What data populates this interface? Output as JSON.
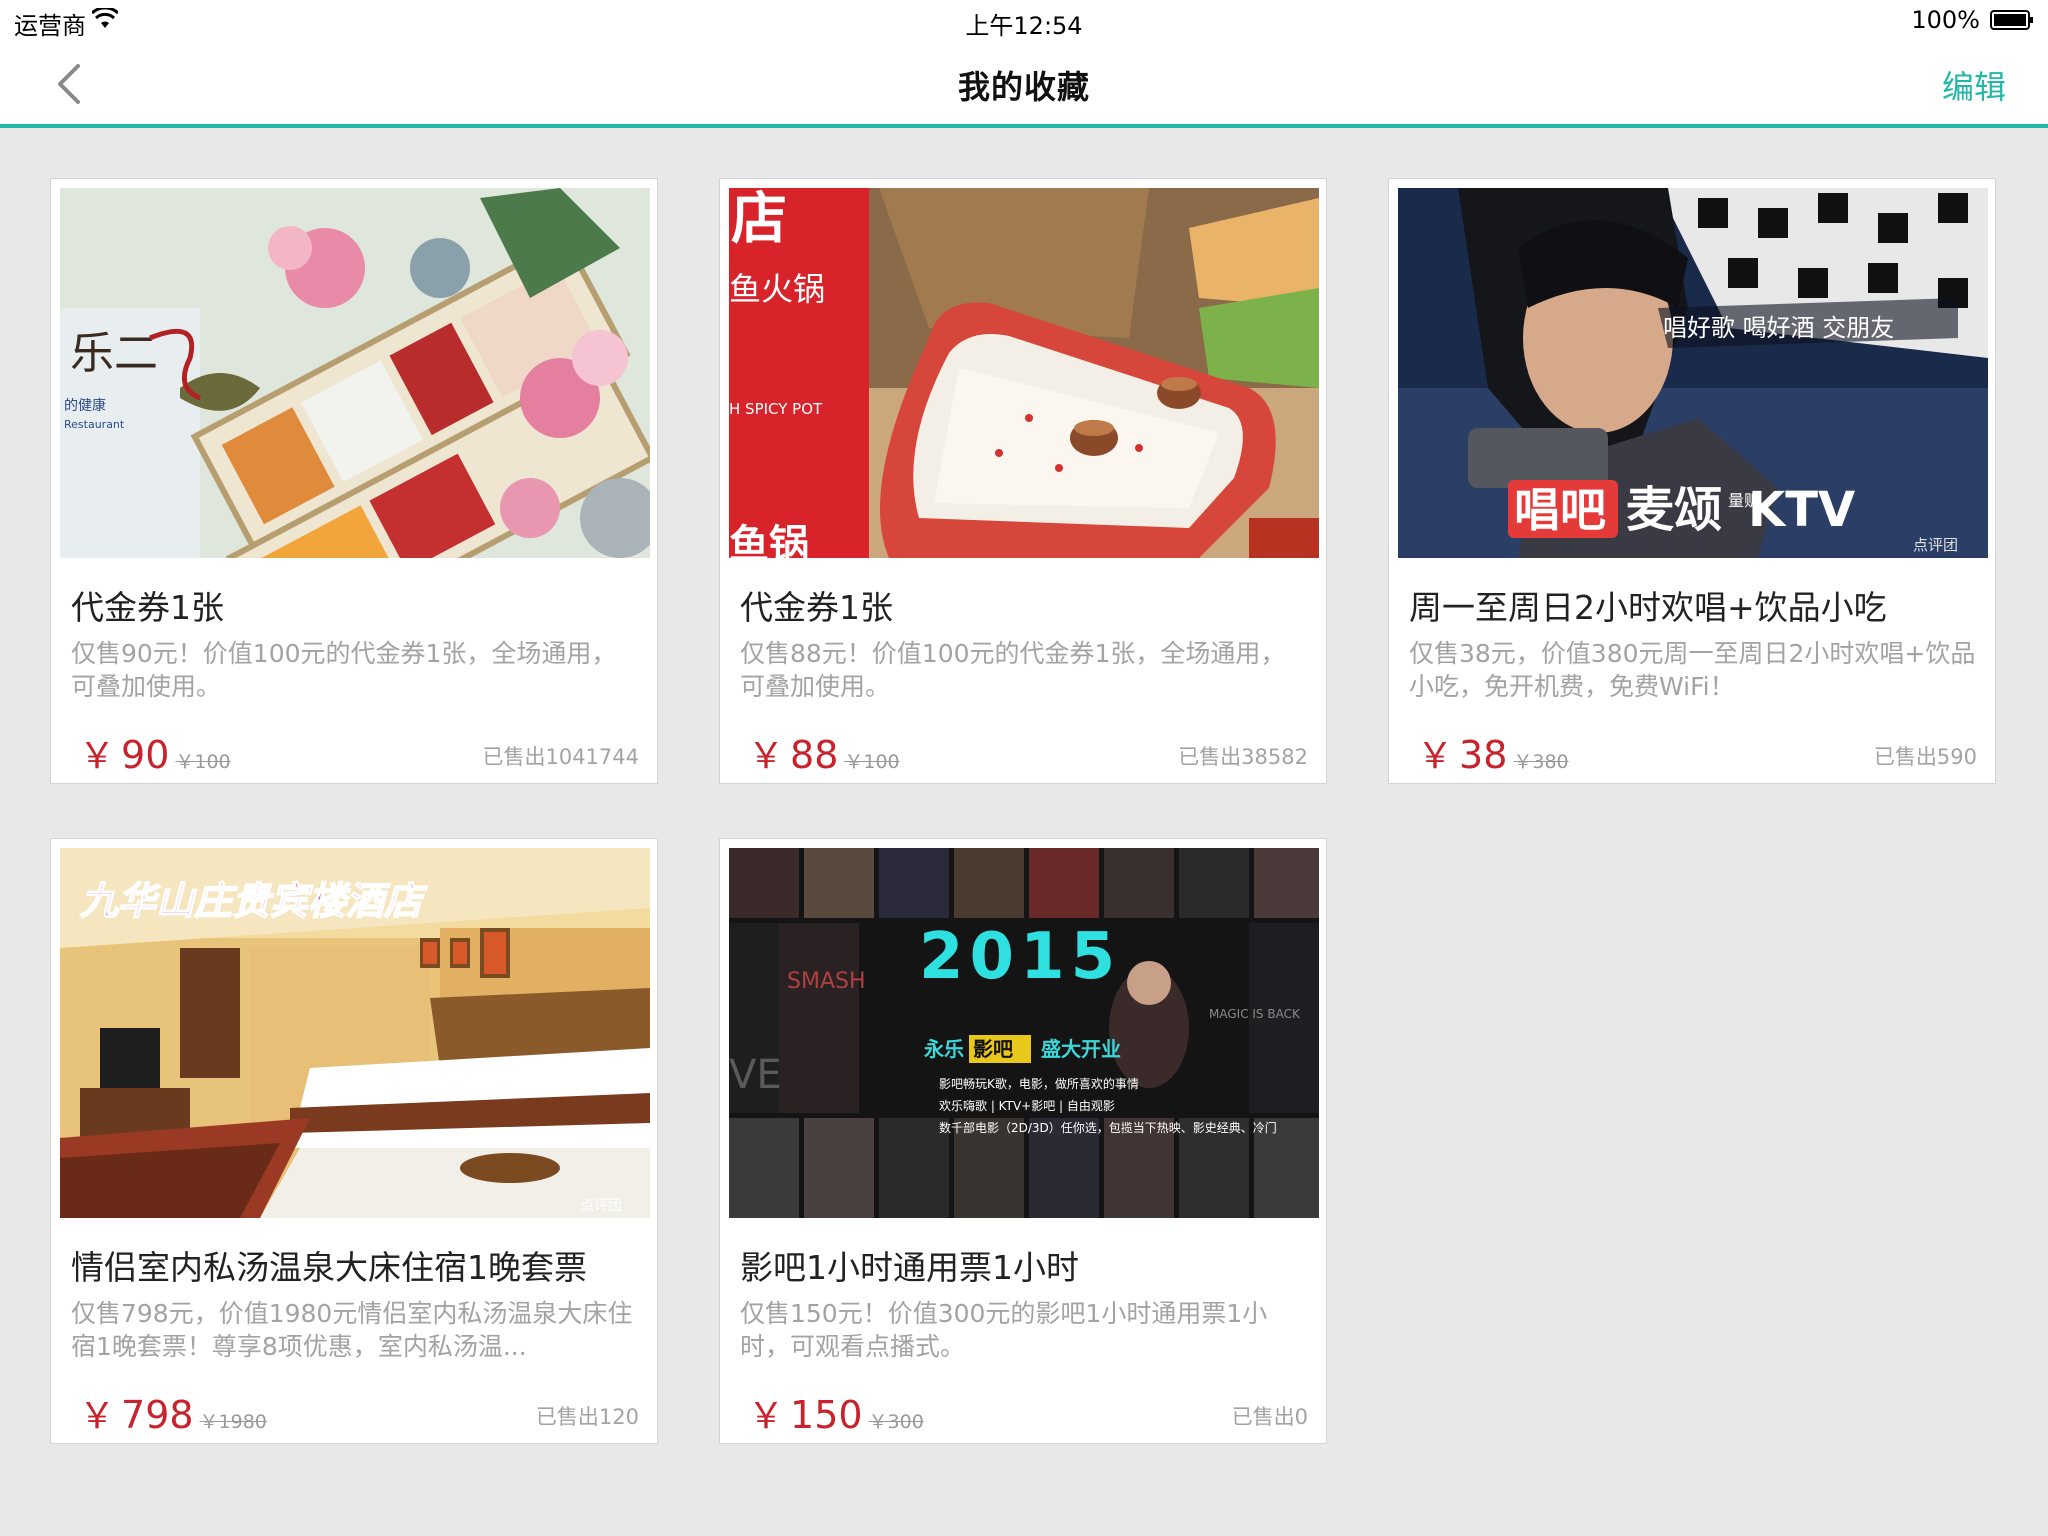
{
  "status_bar": {
    "carrier": "运营商",
    "time": "上午12:54",
    "battery": "100%"
  },
  "nav": {
    "title": "我的收藏",
    "edit_label": "编辑",
    "back_icon": "chevron-left-icon"
  },
  "accent_color": "#22b8a8",
  "price_color": "#c8232c",
  "items": [
    {
      "title": "代金券1张",
      "desc": "仅售90元！价值100元的代金券1张，全场通用，可叠加使用。",
      "currency": "￥",
      "price": "90",
      "orig_price": "￥100",
      "sold": "已售出1041744",
      "image_text": [
        "乐二",
        "的健康",
        "Restaurant"
      ]
    },
    {
      "title": "代金券1张",
      "desc": "仅售88元！价值100元的代金券1张，全场通用，可叠加使用。",
      "currency": "￥",
      "price": "88",
      "orig_price": "￥100",
      "sold": "已售出38582",
      "image_text": [
        "店",
        "鱼火锅",
        "H SPICY POT",
        "鱼锅"
      ]
    },
    {
      "title": "周一至周日2小时欢唱+饮品小吃",
      "desc": "仅售38元，价值380元周一至周日2小时欢唱+饮品小吃，免开机费，免费WiFi！",
      "currency": "￥",
      "price": "38",
      "orig_price": "￥380",
      "sold": "已售出590",
      "image_text": [
        "唱好歌 喝好酒 交朋友",
        "唱吧",
        "麦颂",
        "量贩",
        "KTV",
        "点评团"
      ]
    },
    {
      "title": "情侣室内私汤温泉大床住宿1晚套票",
      "desc": "仅售798元，价值1980元情侣室内私汤温泉大床住宿1晚套票！尊享8项优惠，室内私汤温...",
      "currency": "￥",
      "price": "798",
      "orig_price": "￥1980",
      "sold": "已售出120",
      "image_text": [
        "九华山庄贵宾楼酒店",
        "点评团"
      ]
    },
    {
      "title": "影吧1小时通用票1小时",
      "desc": "仅售150元！价值300元的影吧1小时通用票1小时，可观看点播式。",
      "currency": "￥",
      "price": "150",
      "orig_price": "￥300",
      "sold": "已售出0",
      "image_text": [
        "2015",
        "永乐",
        "影吧",
        "盛大开业",
        "影吧畅玩K歌，电影，做所喜欢的事情",
        "欢乐嗨歌 | KTV+影吧 | 自由观影",
        "数千部电影（2D/3D）任你选，包揽当下热映、影史经典、冷门",
        "SMASH",
        "MAGIC IS BACK",
        "VE"
      ]
    }
  ]
}
